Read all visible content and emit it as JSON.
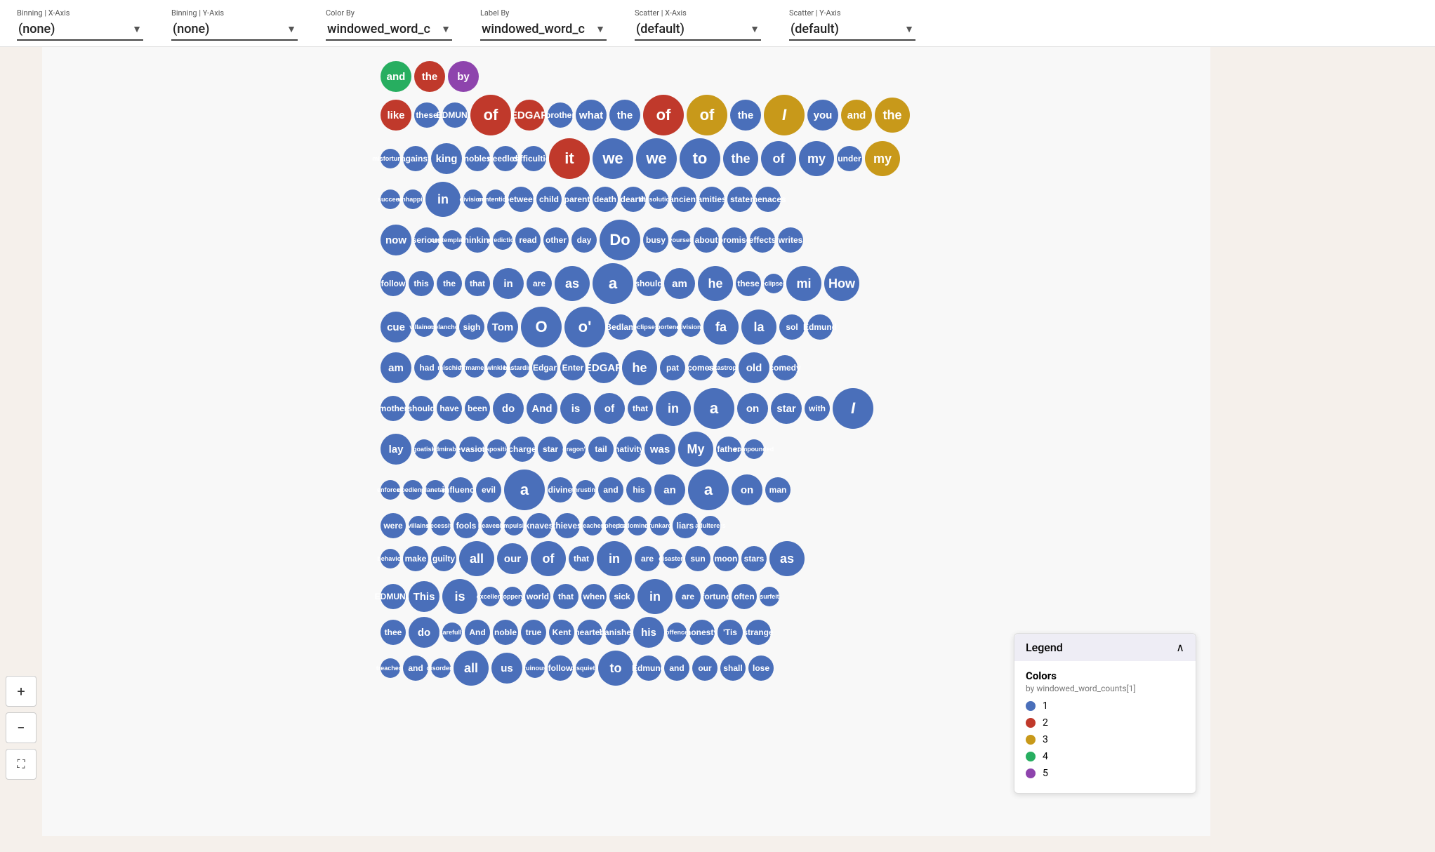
{
  "toolbar": {
    "groups": [
      {
        "label": "Binning | X-Axis",
        "value": "(none)",
        "id": "binning-x"
      },
      {
        "label": "Binning | Y-Axis",
        "value": "(none)",
        "id": "binning-y"
      },
      {
        "label": "Color By",
        "value": "windowed_word_c",
        "id": "color-by"
      },
      {
        "label": "Label By",
        "value": "windowed_word_c",
        "id": "label-by"
      },
      {
        "label": "Scatter | X-Axis",
        "value": "(default)",
        "id": "scatter-x"
      },
      {
        "label": "Scatter | Y-Axis",
        "value": "(default)",
        "id": "scatter-y"
      }
    ]
  },
  "legend": {
    "title": "Legend",
    "section_title": "Colors",
    "subtitle": "by windowed_word_counts[1]",
    "items": [
      {
        "label": "1",
        "color": "#4a6fba"
      },
      {
        "label": "2",
        "color": "#c0392b"
      },
      {
        "label": "3",
        "color": "#c8991a"
      },
      {
        "label": "4",
        "color": "#27ae60"
      },
      {
        "label": "5",
        "color": "#8e44ad"
      }
    ]
  },
  "zoom": {
    "plus": "+",
    "minus": "−",
    "fit": "⛶"
  }
}
